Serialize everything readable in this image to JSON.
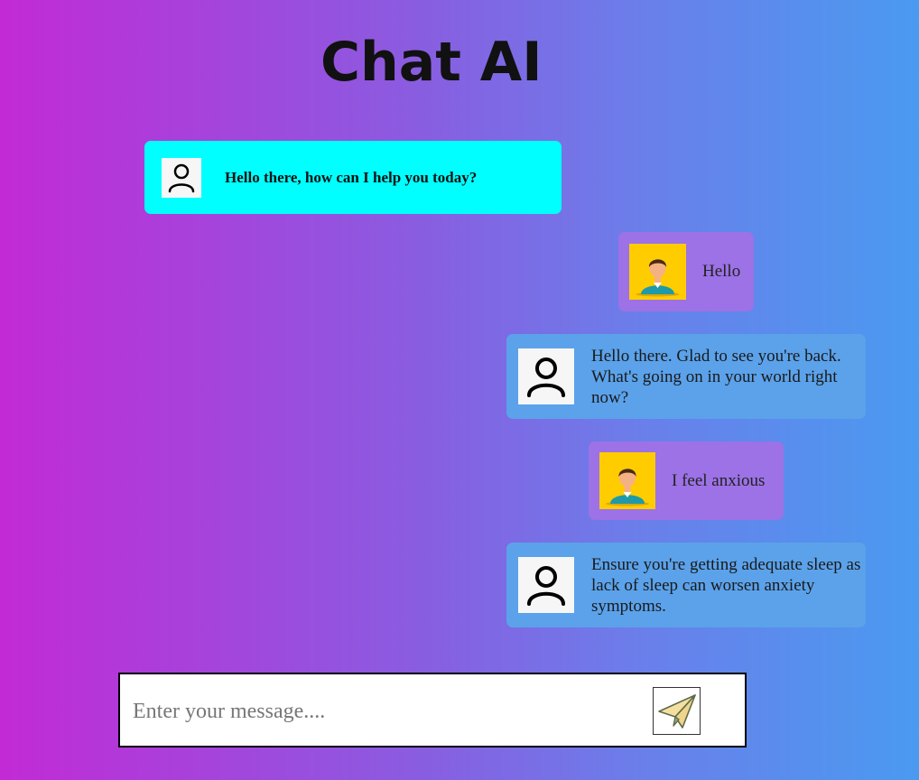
{
  "app": {
    "title": "Chat AI"
  },
  "messages": [
    {
      "role": "bot",
      "avatar_icon": "user-outline-icon",
      "text": "Hello there, how can I help you today?"
    },
    {
      "role": "user",
      "avatar_icon": "person-avatar-icon",
      "text": "Hello"
    },
    {
      "role": "bot",
      "avatar_icon": "user-outline-icon",
      "text": "Hello there. Glad to see you're back. What's going on in your world right now?"
    },
    {
      "role": "user",
      "avatar_icon": "person-avatar-icon",
      "text": "I feel anxious"
    },
    {
      "role": "bot",
      "avatar_icon": "user-outline-icon",
      "text": "Ensure you're getting adequate sleep as lack of sleep can worsen anxiety symptoms."
    }
  ],
  "composer": {
    "placeholder": "Enter your message....",
    "value": "",
    "send_icon": "paper-plane-icon"
  },
  "colors": {
    "greeting_bubble": "#00ffff",
    "user_bubble": "#9c72e6",
    "bot_bubble": "#5ba2ea",
    "user_avatar_bg": "#ffcc00",
    "background_start": "#c22ad6",
    "background_end": "#4a9af0"
  }
}
